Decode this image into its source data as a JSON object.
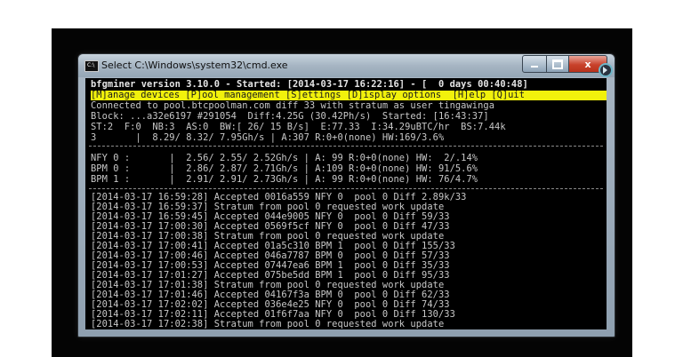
{
  "window": {
    "title": "Select C:\\Windows\\system32\\cmd.exe",
    "icon_label": "C:\\",
    "icon": "cmd-icon",
    "controls": [
      "minimize-icon",
      "maximize-icon",
      "close-icon"
    ],
    "close_glyph": "x"
  },
  "header": {
    "line1": "bfgminer version 3.10.0 - Started: [2014-03-17 16:22:16] - [  0 days 00:40:48]",
    "menu": "[M]anage devices [P]ool management [S]ettings [D]isplay options  [H]elp [Q]uit",
    "connection": "Connected to pool.btcpoolman.com diff 33 with stratum as user tingawinga",
    "block": "Block: ...a32e6197 #291054  Diff:4.25G (30.42Ph/s)  Started: [16:43:37]",
    "stats": "ST:2  F:0  NB:3  AS:0  BW:[ 26/ 15 B/s]  E:77.33  I:34.29uBTC/hr  BS:7.44k",
    "totals": "3       |  8.29/ 8.32/ 7.95Gh/s | A:307 R:0+0(none) HW:169/3.6%"
  },
  "devices": [
    "NFY 0 :       |  2.56/ 2.55/ 2.52Gh/s | A: 99 R:0+0(none) HW:  2/.14%",
    "BPM 0 :       |  2.86/ 2.87/ 2.71Gh/s | A:109 R:0+0(none) HW: 91/5.6%",
    "BPM 1 :       |  2.91/ 2.91/ 2.73Gh/s | A: 99 R:0+0(none) HW: 76/4.7%"
  ],
  "log": [
    "[2014-03-17 16:59:28] Accepted 0016a559 NFY 0  pool 0 Diff 2.89k/33",
    "[2014-03-17 16:59:37] Stratum from pool 0 requested work update",
    "[2014-03-17 16:59:45] Accepted 044e9005 NFY 0  pool 0 Diff 59/33",
    "[2014-03-17 17:00:30] Accepted 0569f5cf NFY 0  pool 0 Diff 47/33",
    "[2014-03-17 17:00:38] Stratum from pool 0 requested work update",
    "[2014-03-17 17:00:41] Accepted 01a5c310 BPM 1  pool 0 Diff 155/33",
    "[2014-03-17 17:00:46] Accepted 046a7787 BPM 0  pool 0 Diff 57/33",
    "[2014-03-17 17:00:53] Accepted 07447ea6 BPM 1  pool 0 Diff 35/33",
    "[2014-03-17 17:01:27] Accepted 075be5dd BPM 1  pool 0 Diff 95/33",
    "[2014-03-17 17:01:38] Stratum from pool 0 requested work update",
    "[2014-03-17 17:01:46] Accepted 04167f3a BPM 0  pool 0 Diff 62/33",
    "[2014-03-17 17:02:02] Accepted 036e4e25 NFY 0  pool 0 Diff 74/33",
    "[2014-03-17 17:02:11] Accepted 01f6f7aa NFY 0  pool 0 Diff 130/33",
    "[2014-03-17 17:02:38] Stratum from pool 0 requested work update"
  ],
  "colors": {
    "menu_highlight": "#f1f10c",
    "console_bg": "#000000",
    "console_text": "#c8c8c8",
    "close_button": "#c8422b"
  }
}
